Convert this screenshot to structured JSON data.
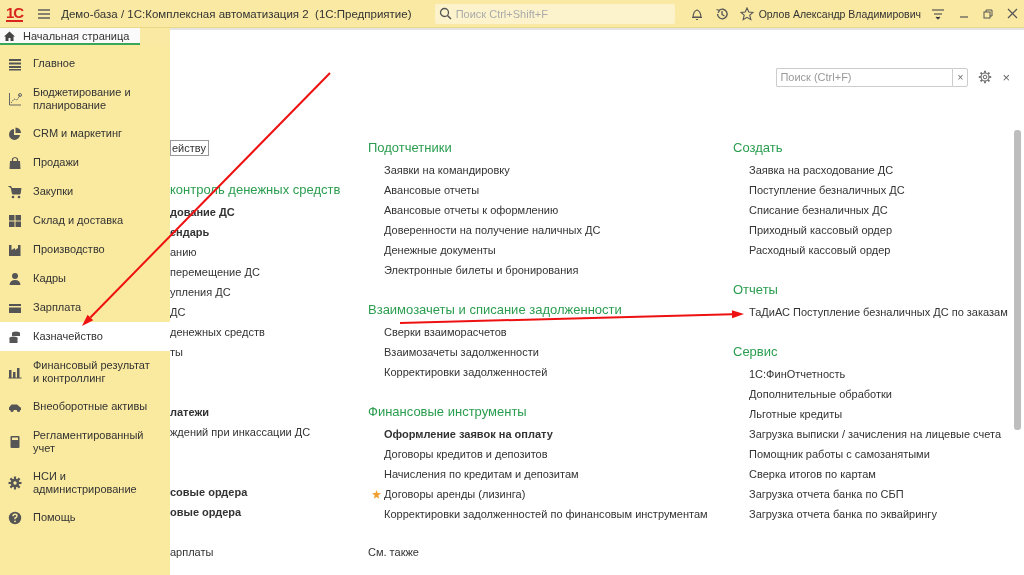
{
  "title_bar": {
    "logo": "1С",
    "title": "Демо-база / 1С:Комплексная автоматизация 2  (1С:Предприятие)",
    "search": {
      "placeholder": "Поиск Ctrl+Shift+F"
    },
    "user": "Орлов Александр Владимирович"
  },
  "tabs": [
    {
      "label": "Начальная страница",
      "selected": true
    }
  ],
  "sidebar": {
    "items": [
      {
        "label": "Главное",
        "selected": false
      },
      {
        "label": "Бюджетирование и планирование",
        "selected": false
      },
      {
        "label": "CRM и маркетинг",
        "selected": false
      },
      {
        "label": "Продажи",
        "selected": false
      },
      {
        "label": "Закупки",
        "selected": false
      },
      {
        "label": "Склад и доставка",
        "selected": false
      },
      {
        "label": "Производство",
        "selected": false
      },
      {
        "label": "Кадры",
        "selected": false
      },
      {
        "label": "Зарплата",
        "selected": false
      },
      {
        "label": "Казначейство",
        "selected": true
      },
      {
        "label": "Финансовый результат и контроллинг",
        "selected": false
      },
      {
        "label": "Внеоборотные активы",
        "selected": false
      },
      {
        "label": "Регламентированный учет",
        "selected": false
      },
      {
        "label": "НСИ и администрирование",
        "selected": false
      },
      {
        "label": "Помощь",
        "selected": false
      }
    ]
  },
  "panel": {
    "search": {
      "placeholder": "Поиск (Ctrl+F)"
    },
    "clear_button": "×",
    "close_button": "×"
  },
  "columns": [
    {
      "groups": [
        {
          "items": [
            {
              "label": "ейству",
              "kind": "button",
              "bold": false
            }
          ]
        },
        {
          "heading": "контроль денежных средств",
          "items": [
            {
              "label": "дование ДС",
              "kind": "link",
              "bold": true
            },
            {
              "label": "ендарь",
              "kind": "link",
              "bold": true
            },
            {
              "label": "анию",
              "kind": "link",
              "bold": false
            },
            {
              "label": "перемещение ДС",
              "kind": "link",
              "bold": false
            },
            {
              "label": "упления ДС",
              "kind": "link",
              "bold": false
            },
            {
              "label": "ДС",
              "kind": "link",
              "bold": false
            },
            {
              "label": "денежных средств",
              "kind": "link",
              "bold": false
            },
            {
              "label": "ты",
              "kind": "link",
              "bold": false
            }
          ]
        },
        {
          "items": [
            {
              "label": "латежи",
              "kind": "link",
              "bold": true
            },
            {
              "label": "ждений при инкассации ДС",
              "kind": "link",
              "bold": false
            }
          ]
        },
        {
          "items": [
            {
              "label": "совые ордера",
              "kind": "link",
              "bold": true
            },
            {
              "label": "овые ордера",
              "kind": "link",
              "bold": true
            }
          ]
        },
        {
          "items": [
            {
              "label": "арплаты",
              "kind": "link",
              "bold": false
            }
          ]
        }
      ]
    },
    {
      "groups": [
        {
          "heading": "Подотчетники",
          "items": [
            {
              "label": "Заявки на командировку",
              "kind": "link",
              "bold": false,
              "favorite": false
            },
            {
              "label": "Авансовые отчеты",
              "kind": "link",
              "bold": false,
              "favorite": false
            },
            {
              "label": "Авансовые отчеты к оформлению",
              "kind": "link",
              "bold": false,
              "favorite": false
            },
            {
              "label": "Доверенности на получение наличных ДС",
              "kind": "link",
              "bold": false,
              "favorite": false
            },
            {
              "label": "Денежные документы",
              "kind": "link",
              "bold": false,
              "favorite": false
            },
            {
              "label": "Электронные билеты и бронирования",
              "kind": "link",
              "bold": false,
              "favorite": false
            }
          ]
        },
        {
          "heading": "Взаимозачеты и списание задолженности",
          "items": [
            {
              "label": "Сверки взаиморасчетов",
              "kind": "link",
              "bold": false,
              "favorite": false
            },
            {
              "label": "Взаимозачеты задолженности",
              "kind": "link",
              "bold": false,
              "favorite": false
            },
            {
              "label": "Корректировки задолженностей",
              "kind": "link",
              "bold": false,
              "favorite": false
            }
          ]
        },
        {
          "heading": "Финансовые инструменты",
          "items": [
            {
              "label": "Оформление заявок на оплату",
              "kind": "link",
              "bold": true,
              "favorite": false
            },
            {
              "label": "Договоры кредитов и депозитов",
              "kind": "link",
              "bold": false,
              "favorite": false
            },
            {
              "label": "Начисления по кредитам и депозитам",
              "kind": "link",
              "bold": false,
              "favorite": false
            },
            {
              "label": "Договоры аренды (лизинга)",
              "kind": "link",
              "bold": false,
              "favorite": true
            },
            {
              "label": "Корректировки задолженностей по финансовым инструментам",
              "kind": "link",
              "bold": false,
              "favorite": false
            }
          ]
        }
      ],
      "footer": "См. также"
    },
    {
      "groups": [
        {
          "heading": "Создать",
          "items": [
            {
              "label": "Заявка на расходование ДС",
              "kind": "link",
              "bold": false
            },
            {
              "label": "Поступление безналичных ДС",
              "kind": "link",
              "bold": false
            },
            {
              "label": "Списание безналичных ДС",
              "kind": "link",
              "bold": false
            },
            {
              "label": "Приходный кассовый ордер",
              "kind": "link",
              "bold": false
            },
            {
              "label": "Расходный кассовый ордер",
              "kind": "link",
              "bold": false
            }
          ]
        },
        {
          "heading": "Отчеты",
          "items": [
            {
              "label": "ТаДиАС Поступление безналичных ДС по заказам",
              "kind": "link",
              "bold": false
            }
          ]
        },
        {
          "heading": "Сервис",
          "items": [
            {
              "label": "1С:ФинОтчетность",
              "kind": "link",
              "bold": false
            },
            {
              "label": "Дополнительные обработки",
              "kind": "link",
              "bold": false
            },
            {
              "label": "Льготные кредиты",
              "kind": "link",
              "bold": false
            },
            {
              "label": "Загрузка выписки / зачисления на лицевые счета",
              "kind": "link",
              "bold": false
            },
            {
              "label": "Помощник работы с самозанятыми",
              "kind": "link",
              "bold": false
            },
            {
              "label": "Сверка итогов по картам",
              "kind": "link",
              "bold": false
            },
            {
              "label": "Загрузка отчета банка по СБП",
              "kind": "link",
              "bold": false
            },
            {
              "label": "Загрузка отчета банка по эквайрингу",
              "kind": "link",
              "bold": false
            }
          ]
        }
      ]
    }
  ],
  "annotations": [
    {
      "kind": "arrow"
    },
    {
      "kind": "arrow"
    }
  ]
}
